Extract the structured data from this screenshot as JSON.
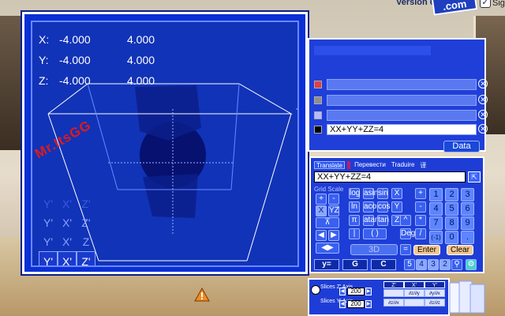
{
  "header": {
    "version_label": "Version 6.0",
    "logo_text": ".com",
    "sig_label": "Sig"
  },
  "viewer": {
    "coords": {
      "x_label": "X:",
      "x_min": "-4.000",
      "x_max": "4.000",
      "y_label": "Y:",
      "y_min": "-4.000",
      "y_max": "4.000",
      "z_label": "Z:",
      "z_min": "-4.000",
      "z_max": "4.000"
    },
    "watermark": "Mr.ItsGG",
    "axis_views": [
      [
        "Y'",
        "X'",
        "Z'"
      ],
      [
        "Y'",
        "X'",
        "Z'"
      ],
      [
        "Y'",
        "X'",
        "Z"
      ],
      [
        "Y'",
        "X'",
        "Z'"
      ]
    ]
  },
  "equations": {
    "rows": [
      {
        "color": "#e04040",
        "value": ""
      },
      {
        "color": "#8f8f8f",
        "value": ""
      },
      {
        "color": "#b8b8ff",
        "value": ""
      },
      {
        "color": "#000000",
        "value": "XX+YY+ZZ=4"
      }
    ],
    "data_button": "Data"
  },
  "calculator": {
    "tabs": [
      "Translate",
      "",
      "Перевести",
      "Traduire",
      "译"
    ],
    "input_value": "XX+YY+ZZ=4",
    "grid_scale_label": "Grid Scale",
    "func_keys": [
      "log",
      "asin",
      "sin",
      "ln",
      "acos",
      "cos",
      "π",
      "atan",
      "tan",
      "|",
      "( )",
      "Deg"
    ],
    "num_keys": [
      "1",
      "2",
      "3",
      "4",
      "5",
      "6",
      "7",
      "8",
      "9",
      "(-1)",
      "0",
      "."
    ],
    "op_keys": [
      "+",
      "-",
      "*",
      "/",
      "^",
      "="
    ],
    "btn_3d": "3D",
    "btn_enter": "Enter",
    "btn_clear": "Clear",
    "bottom_keys": [
      "y=",
      "G",
      "C"
    ],
    "page_keys": [
      "5",
      "4",
      "3",
      "2"
    ]
  },
  "slices": {
    "row1_label": "Slices\nZ' Axis",
    "row2_label": "Slices\nY' Axis",
    "row1_value": "200",
    "row2_value": "200",
    "headers": [
      "Z'",
      "X'",
      "Y'"
    ],
    "cells": [
      "",
      "∂z/∂y",
      "∂y/∂x",
      "∂z/∂x",
      "",
      "∂z/∂z"
    ]
  }
}
